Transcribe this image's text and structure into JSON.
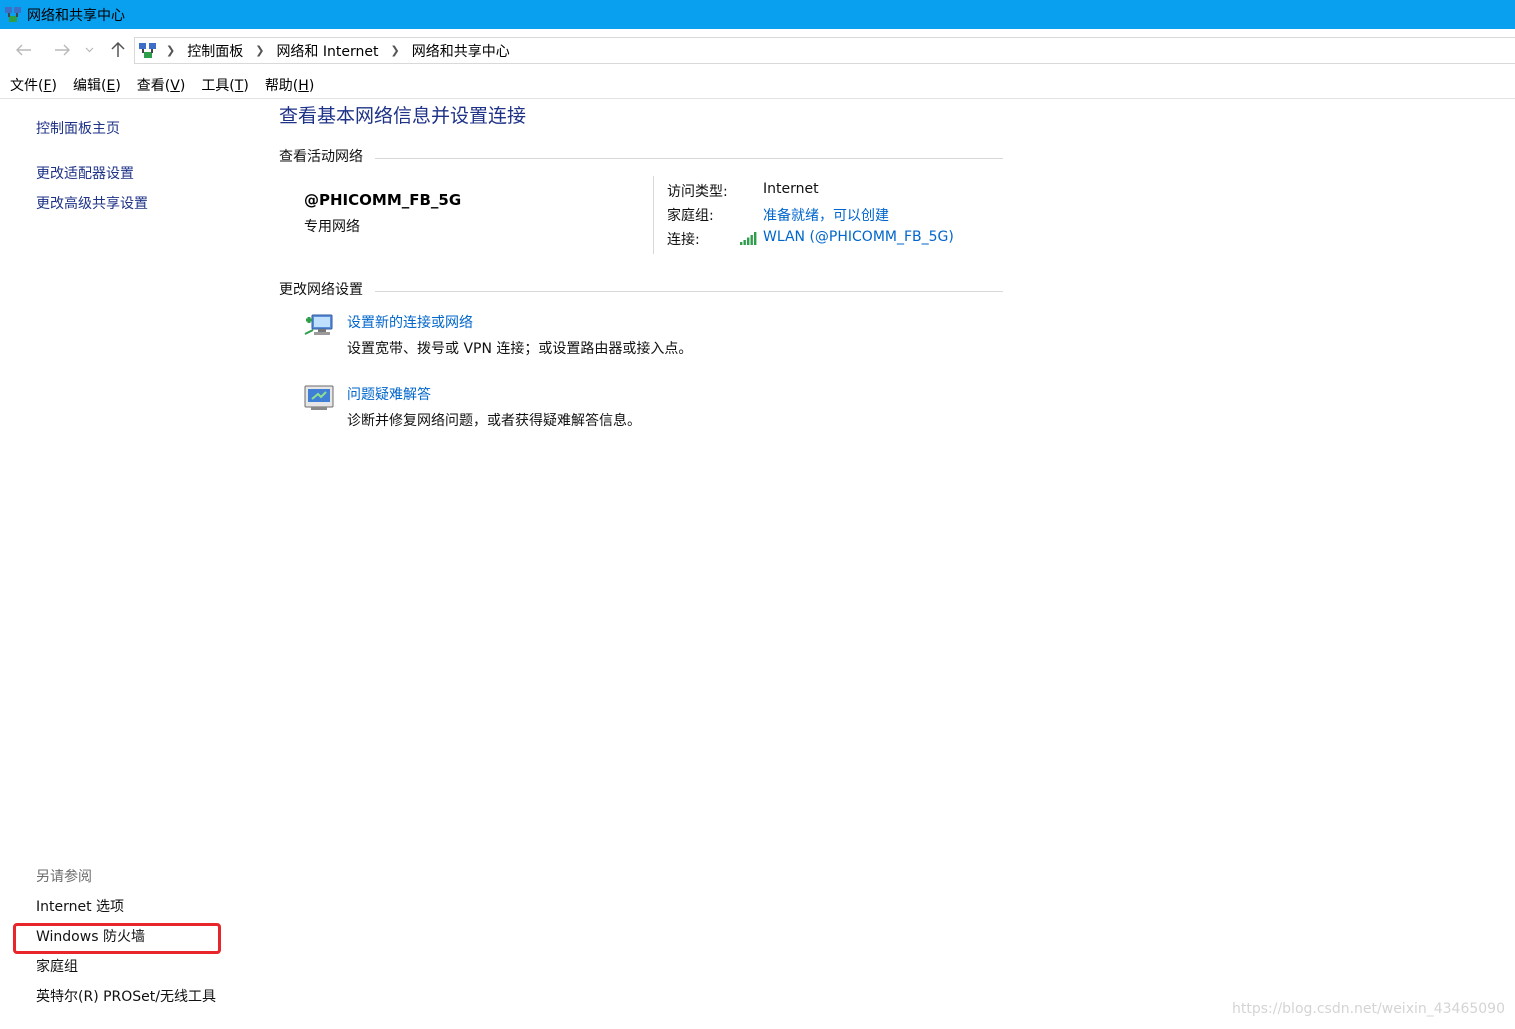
{
  "window": {
    "title": "网络和共享中心",
    "icon": "network-sharing-center-icon"
  },
  "navigation": {
    "back_icon": "back-arrow-icon",
    "forward_icon": "forward-arrow-icon",
    "recent_icon": "chevron-down-icon",
    "up_icon": "up-arrow-icon",
    "breadcrumbs": [
      "控制面板",
      "网络和 Internet",
      "网络和共享中心"
    ]
  },
  "menubar": {
    "items": [
      {
        "label": "文件(",
        "key": "F",
        "tail": ")"
      },
      {
        "label": "编辑(",
        "key": "E",
        "tail": ")"
      },
      {
        "label": "查看(",
        "key": "V",
        "tail": ")"
      },
      {
        "label": "工具(",
        "key": "T",
        "tail": ")"
      },
      {
        "label": "帮助(",
        "key": "H",
        "tail": ")"
      }
    ]
  },
  "sidebar": {
    "items": [
      "控制面板主页",
      "更改适配器设置",
      "更改高级共享设置"
    ],
    "see_also_header": "另请参阅",
    "see_also": [
      "Internet 选项",
      "Windows 防火墙",
      "家庭组",
      "英特尔(R) PROSet/无线工具"
    ]
  },
  "main": {
    "title": "查看基本网络信息并设置连接",
    "active_networks_header": "查看活动网络",
    "network": {
      "name": "@PHICOMM_FB_5G",
      "type": "专用网络",
      "access_type_label": "访问类型:",
      "access_type_value": "Internet",
      "homegroup_label": "家庭组:",
      "homegroup_value": "准备就绪，可以创建",
      "connection_label": "连接:",
      "connection_value": "WLAN (@PHICOMM_FB_5G)",
      "connection_icon": "wifi-signal-icon"
    },
    "change_settings_header": "更改网络设置",
    "tasks": [
      {
        "title": "设置新的连接或网络",
        "desc": "设置宽带、拨号或 VPN 连接；或设置路由器或接入点。",
        "icon": "new-connection-icon"
      },
      {
        "title": "问题疑难解答",
        "desc": "诊断并修复网络问题，或者获得疑难解答信息。",
        "icon": "troubleshoot-icon"
      }
    ]
  },
  "annotation": {
    "color": "#e8252a"
  },
  "watermark": "https://blog.csdn.net/weixin_43465090",
  "colors": {
    "titlebar": "#0aa0f0",
    "link": "#0066cc",
    "heading": "#1e3287"
  }
}
